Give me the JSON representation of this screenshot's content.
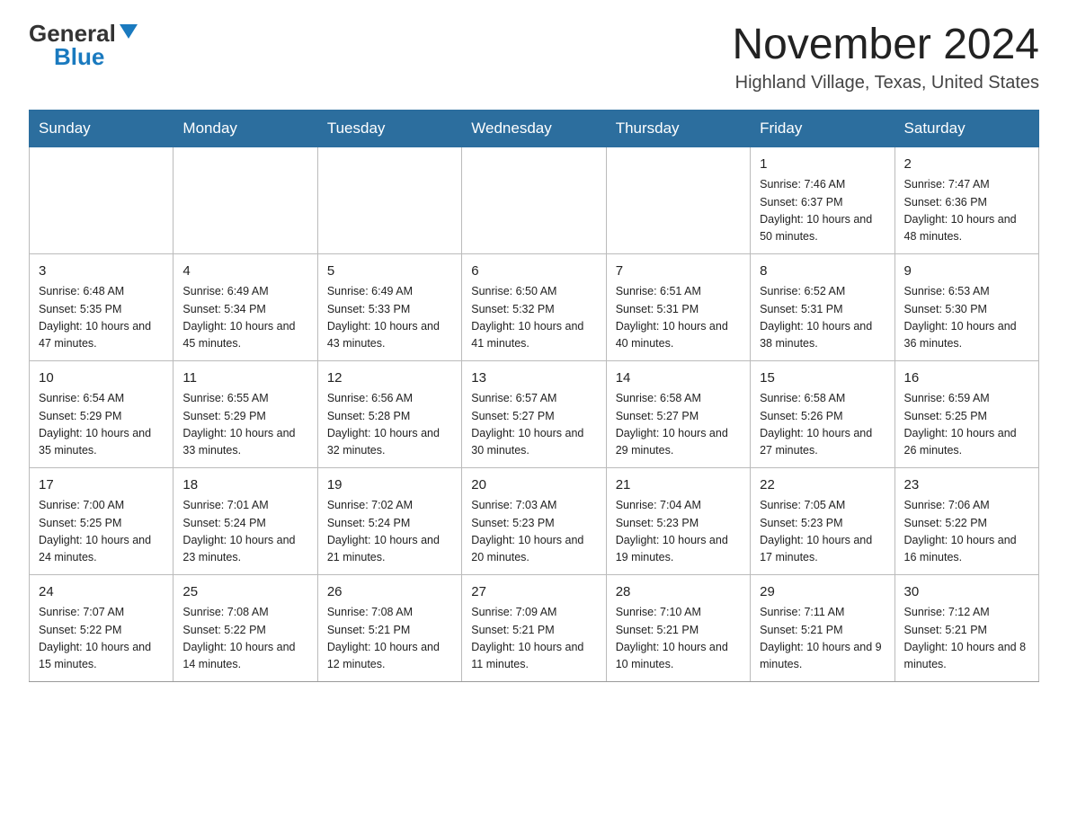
{
  "header": {
    "logo_general": "General",
    "logo_blue": "Blue",
    "month_title": "November 2024",
    "location": "Highland Village, Texas, United States"
  },
  "weekdays": [
    "Sunday",
    "Monday",
    "Tuesday",
    "Wednesday",
    "Thursday",
    "Friday",
    "Saturday"
  ],
  "weeks": [
    [
      {
        "day": "",
        "info": ""
      },
      {
        "day": "",
        "info": ""
      },
      {
        "day": "",
        "info": ""
      },
      {
        "day": "",
        "info": ""
      },
      {
        "day": "",
        "info": ""
      },
      {
        "day": "1",
        "info": "Sunrise: 7:46 AM\nSunset: 6:37 PM\nDaylight: 10 hours and 50 minutes."
      },
      {
        "day": "2",
        "info": "Sunrise: 7:47 AM\nSunset: 6:36 PM\nDaylight: 10 hours and 48 minutes."
      }
    ],
    [
      {
        "day": "3",
        "info": "Sunrise: 6:48 AM\nSunset: 5:35 PM\nDaylight: 10 hours and 47 minutes."
      },
      {
        "day": "4",
        "info": "Sunrise: 6:49 AM\nSunset: 5:34 PM\nDaylight: 10 hours and 45 minutes."
      },
      {
        "day": "5",
        "info": "Sunrise: 6:49 AM\nSunset: 5:33 PM\nDaylight: 10 hours and 43 minutes."
      },
      {
        "day": "6",
        "info": "Sunrise: 6:50 AM\nSunset: 5:32 PM\nDaylight: 10 hours and 41 minutes."
      },
      {
        "day": "7",
        "info": "Sunrise: 6:51 AM\nSunset: 5:31 PM\nDaylight: 10 hours and 40 minutes."
      },
      {
        "day": "8",
        "info": "Sunrise: 6:52 AM\nSunset: 5:31 PM\nDaylight: 10 hours and 38 minutes."
      },
      {
        "day": "9",
        "info": "Sunrise: 6:53 AM\nSunset: 5:30 PM\nDaylight: 10 hours and 36 minutes."
      }
    ],
    [
      {
        "day": "10",
        "info": "Sunrise: 6:54 AM\nSunset: 5:29 PM\nDaylight: 10 hours and 35 minutes."
      },
      {
        "day": "11",
        "info": "Sunrise: 6:55 AM\nSunset: 5:29 PM\nDaylight: 10 hours and 33 minutes."
      },
      {
        "day": "12",
        "info": "Sunrise: 6:56 AM\nSunset: 5:28 PM\nDaylight: 10 hours and 32 minutes."
      },
      {
        "day": "13",
        "info": "Sunrise: 6:57 AM\nSunset: 5:27 PM\nDaylight: 10 hours and 30 minutes."
      },
      {
        "day": "14",
        "info": "Sunrise: 6:58 AM\nSunset: 5:27 PM\nDaylight: 10 hours and 29 minutes."
      },
      {
        "day": "15",
        "info": "Sunrise: 6:58 AM\nSunset: 5:26 PM\nDaylight: 10 hours and 27 minutes."
      },
      {
        "day": "16",
        "info": "Sunrise: 6:59 AM\nSunset: 5:25 PM\nDaylight: 10 hours and 26 minutes."
      }
    ],
    [
      {
        "day": "17",
        "info": "Sunrise: 7:00 AM\nSunset: 5:25 PM\nDaylight: 10 hours and 24 minutes."
      },
      {
        "day": "18",
        "info": "Sunrise: 7:01 AM\nSunset: 5:24 PM\nDaylight: 10 hours and 23 minutes."
      },
      {
        "day": "19",
        "info": "Sunrise: 7:02 AM\nSunset: 5:24 PM\nDaylight: 10 hours and 21 minutes."
      },
      {
        "day": "20",
        "info": "Sunrise: 7:03 AM\nSunset: 5:23 PM\nDaylight: 10 hours and 20 minutes."
      },
      {
        "day": "21",
        "info": "Sunrise: 7:04 AM\nSunset: 5:23 PM\nDaylight: 10 hours and 19 minutes."
      },
      {
        "day": "22",
        "info": "Sunrise: 7:05 AM\nSunset: 5:23 PM\nDaylight: 10 hours and 17 minutes."
      },
      {
        "day": "23",
        "info": "Sunrise: 7:06 AM\nSunset: 5:22 PM\nDaylight: 10 hours and 16 minutes."
      }
    ],
    [
      {
        "day": "24",
        "info": "Sunrise: 7:07 AM\nSunset: 5:22 PM\nDaylight: 10 hours and 15 minutes."
      },
      {
        "day": "25",
        "info": "Sunrise: 7:08 AM\nSunset: 5:22 PM\nDaylight: 10 hours and 14 minutes."
      },
      {
        "day": "26",
        "info": "Sunrise: 7:08 AM\nSunset: 5:21 PM\nDaylight: 10 hours and 12 minutes."
      },
      {
        "day": "27",
        "info": "Sunrise: 7:09 AM\nSunset: 5:21 PM\nDaylight: 10 hours and 11 minutes."
      },
      {
        "day": "28",
        "info": "Sunrise: 7:10 AM\nSunset: 5:21 PM\nDaylight: 10 hours and 10 minutes."
      },
      {
        "day": "29",
        "info": "Sunrise: 7:11 AM\nSunset: 5:21 PM\nDaylight: 10 hours and 9 minutes."
      },
      {
        "day": "30",
        "info": "Sunrise: 7:12 AM\nSunset: 5:21 PM\nDaylight: 10 hours and 8 minutes."
      }
    ]
  ]
}
